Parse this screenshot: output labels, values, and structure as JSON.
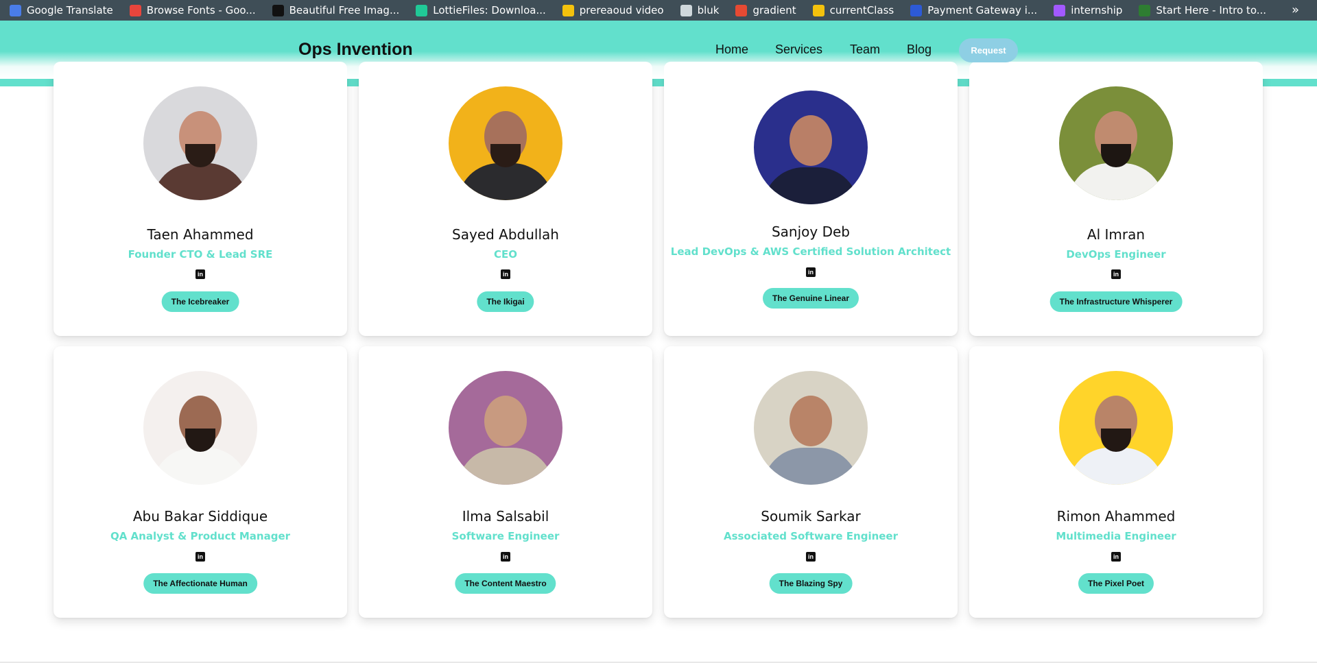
{
  "bookmarks": [
    {
      "label": "Google Translate",
      "icon": "translate-icon",
      "color": "#4a7de8"
    },
    {
      "label": "Browse Fonts - Goo...",
      "icon": "fonts-icon",
      "color": "#e8453c"
    },
    {
      "label": "Beautiful Free Imag...",
      "icon": "unsplash-icon",
      "color": "#111111"
    },
    {
      "label": "LottieFiles: Downloa...",
      "icon": "lottie-icon",
      "color": "#20c997"
    },
    {
      "label": "prereaoud video",
      "icon": "video-icon",
      "color": "#f4c20d"
    },
    {
      "label": "bluk",
      "icon": "globe-icon",
      "color": "#cfd8dc"
    },
    {
      "label": "gradient",
      "icon": "gradient-icon",
      "color": "#e64a33"
    },
    {
      "label": "currentClass",
      "icon": "class-icon",
      "color": "#f4c20d"
    },
    {
      "label": "Payment Gateway i...",
      "icon": "payment-icon",
      "color": "#2d5ad6"
    },
    {
      "label": "internship",
      "icon": "figma-icon",
      "color": "#a259ff"
    },
    {
      "label": "Start Here - Intro to...",
      "icon": "node-icon",
      "color": "#2e7d32"
    }
  ],
  "header": {
    "brand": "Ops Invention",
    "nav": [
      "Home",
      "Services",
      "Team",
      "Blog"
    ],
    "request": "Request"
  },
  "team": [
    {
      "name": "Taen Ahammed",
      "role": "Founder CTO & Lead SRE",
      "tag": "The Icebreaker",
      "bg": "#d9d9dc",
      "skin": "#c8917a",
      "shirt": "#5a3a33",
      "beard": "#2a1c16"
    },
    {
      "name": "Sayed Abdullah",
      "role": "CEO",
      "tag": "The Ikigai",
      "bg": "#f2b21a",
      "skin": "#a7715b",
      "shirt": "#2b2b2e",
      "beard": "#2a1c16"
    },
    {
      "name": "Sanjoy Deb",
      "role": "Lead DevOps & AWS Certified Solution Architect",
      "tag": "The Genuine Linear",
      "bg": "#2a2f8c",
      "skin": "#b97f67",
      "shirt": "#1b1f3a",
      "beard": ""
    },
    {
      "name": "Al Imran",
      "role": "DevOps Engineer",
      "tag": "The Infrastructure Whisperer",
      "bg": "#7b8f3a",
      "skin": "#c08b6f",
      "shirt": "#f2f2ef",
      "beard": "#1d1612"
    },
    {
      "name": "Abu Bakar Siddique",
      "role": "QA Analyst & Product Manager",
      "tag": "The Affectionate Human",
      "bg": "#f4f0ee",
      "skin": "#9c6a53",
      "shirt": "#f7f7f5",
      "beard": "#221814"
    },
    {
      "name": "Ilma Salsabil",
      "role": "Software Engineer",
      "tag": "The Content Maestro",
      "bg": "#a56a9a",
      "skin": "#c89a80",
      "shirt": "#c7b9a8",
      "beard": ""
    },
    {
      "name": "Soumik Sarkar",
      "role": "Associated Software Engineer",
      "tag": "The Blazing Spy",
      "bg": "#d8d3c5",
      "skin": "#b98468",
      "shirt": "#8c97a8",
      "beard": ""
    },
    {
      "name": "Rimon Ahammed",
      "role": "Multimedia Engineer",
      "tag": "The Pixel Poet",
      "bg": "#ffd42a",
      "skin": "#b98468",
      "shirt": "#eef1f6",
      "beard": "#221814"
    }
  ],
  "linkedin_label": "in",
  "accent": "#62e0cc"
}
